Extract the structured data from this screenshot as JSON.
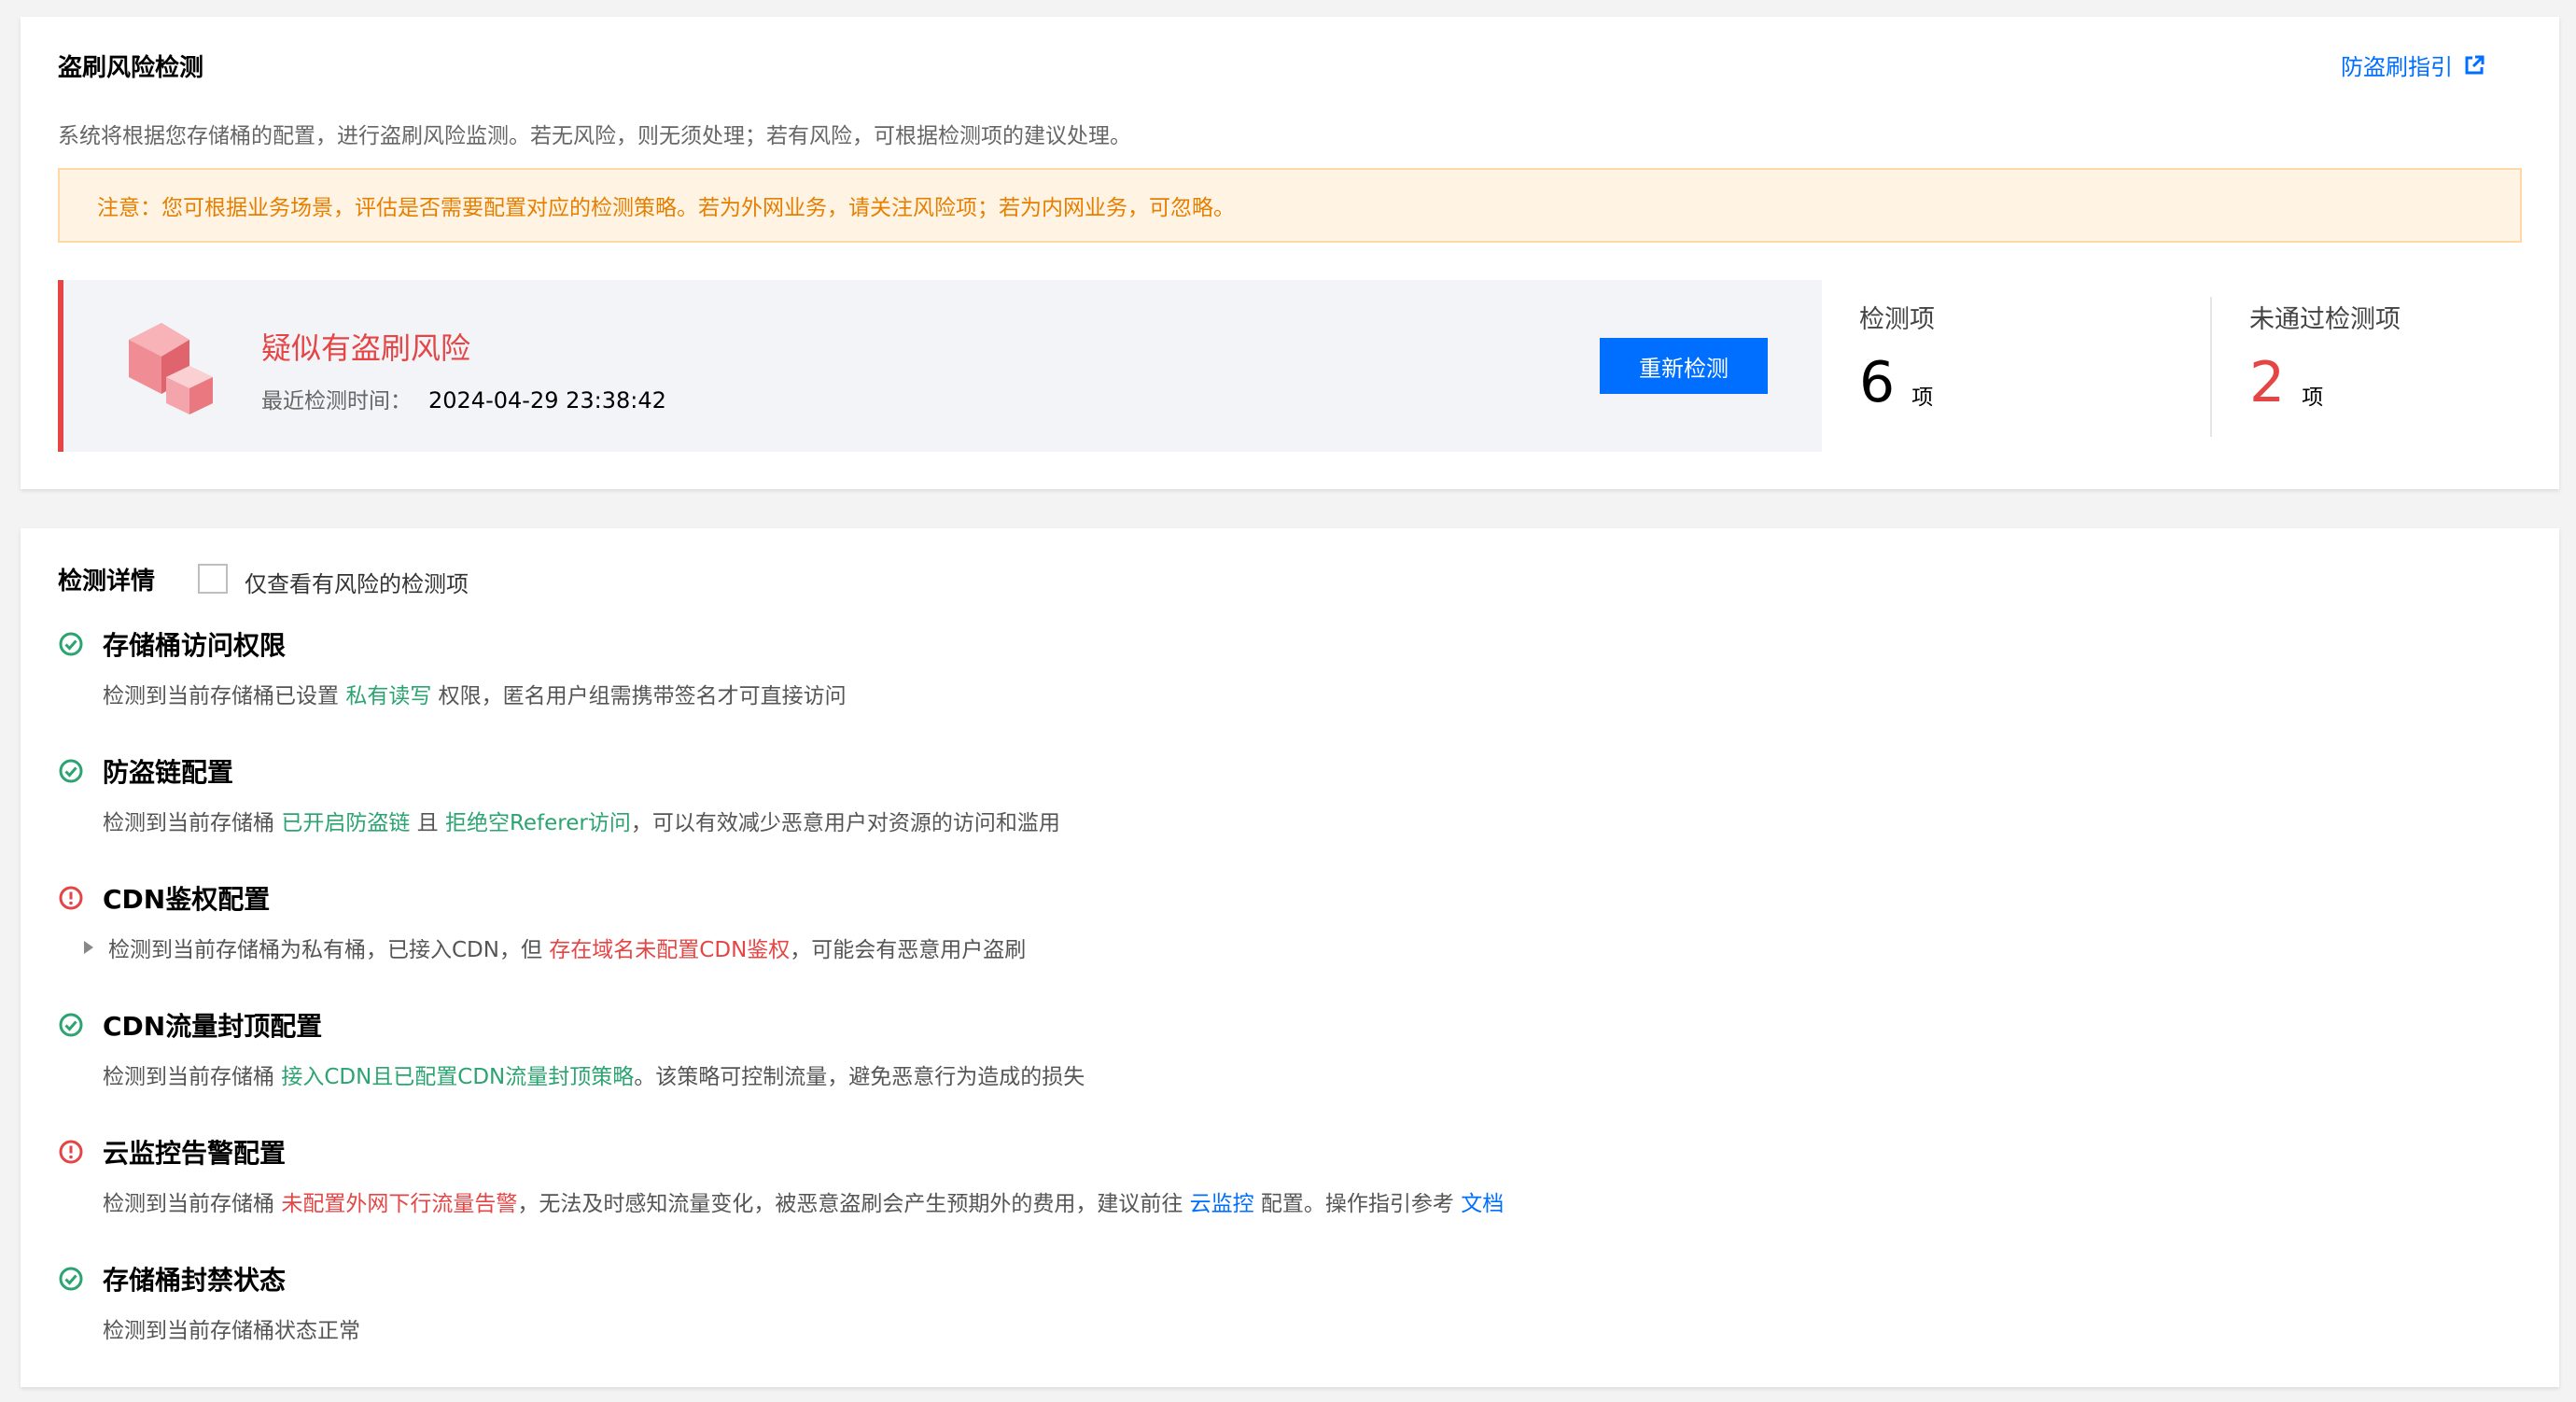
{
  "top": {
    "title": "盗刷风险检测",
    "guide_link": "防盗刷指引",
    "description": "系统将根据您存储桶的配置，进行盗刷风险监测。若无风险，则无须处理；若有风险，可根据检测项的建议处理。",
    "notice": "注意：您可根据业务场景，评估是否需要配置对应的检测策略。若为外网业务，请关注风险项；若为内网业务，可忽略。",
    "status": {
      "title": "疑似有盗刷风险",
      "time_label": "最近检测时间：",
      "time_value": "2024-04-29 23:38:42",
      "recheck_label": "重新检测"
    },
    "stats": {
      "total_label": "检测项",
      "total_value": "6",
      "fail_label": "未通过检测项",
      "fail_value": "2",
      "unit": "项"
    }
  },
  "details": {
    "title": "检测详情",
    "filter_label": "仅查看有风险的检测项",
    "items": [
      {
        "status": "pass",
        "title": "存储桶访问权限",
        "d1": "检测到当前存储桶已设置 ",
        "h1": "私有读写",
        "d2": " 权限，匿名用户组需携带签名才可直接访问"
      },
      {
        "status": "pass",
        "title": "防盗链配置",
        "d1": "检测到当前存储桶 ",
        "h1": "已开启防盗链",
        "d2": " 且 ",
        "h2": "拒绝空Referer访问",
        "d3": "，可以有效减少恶意用户对资源的访问和滥用"
      },
      {
        "status": "fail",
        "title": "CDN鉴权配置",
        "d1": "检测到当前存储桶为私有桶，已接入CDN，但 ",
        "h1": "存在域名未配置CDN鉴权",
        "d2": "，可能会有恶意用户盗刷"
      },
      {
        "status": "pass",
        "title": "CDN流量封顶配置",
        "d1": "检测到当前存储桶 ",
        "h1": "接入CDN且已配置CDN流量封顶策略",
        "d2": "。该策略可控制流量，避免恶意行为造成的损失"
      },
      {
        "status": "fail",
        "title": "云监控告警配置",
        "d1": "检测到当前存储桶 ",
        "h1": "未配置外网下行流量告警",
        "d2": "，无法及时感知流量变化，被恶意盗刷会产生预期外的费用，建议前往 ",
        "l1": "云监控",
        "d3": " 配置。操作指引参考 ",
        "l2": "文档"
      },
      {
        "status": "pass",
        "title": "存储桶封禁状态",
        "d1": "检测到当前存储桶状态正常"
      }
    ]
  },
  "colors": {
    "accent": "#006eff",
    "danger": "#e54545",
    "success": "#2ba471",
    "warning_text": "#e67e00"
  },
  "icons": {
    "pass": "check-circle-icon",
    "fail": "warning-circle-icon",
    "link": "external-link-icon"
  }
}
